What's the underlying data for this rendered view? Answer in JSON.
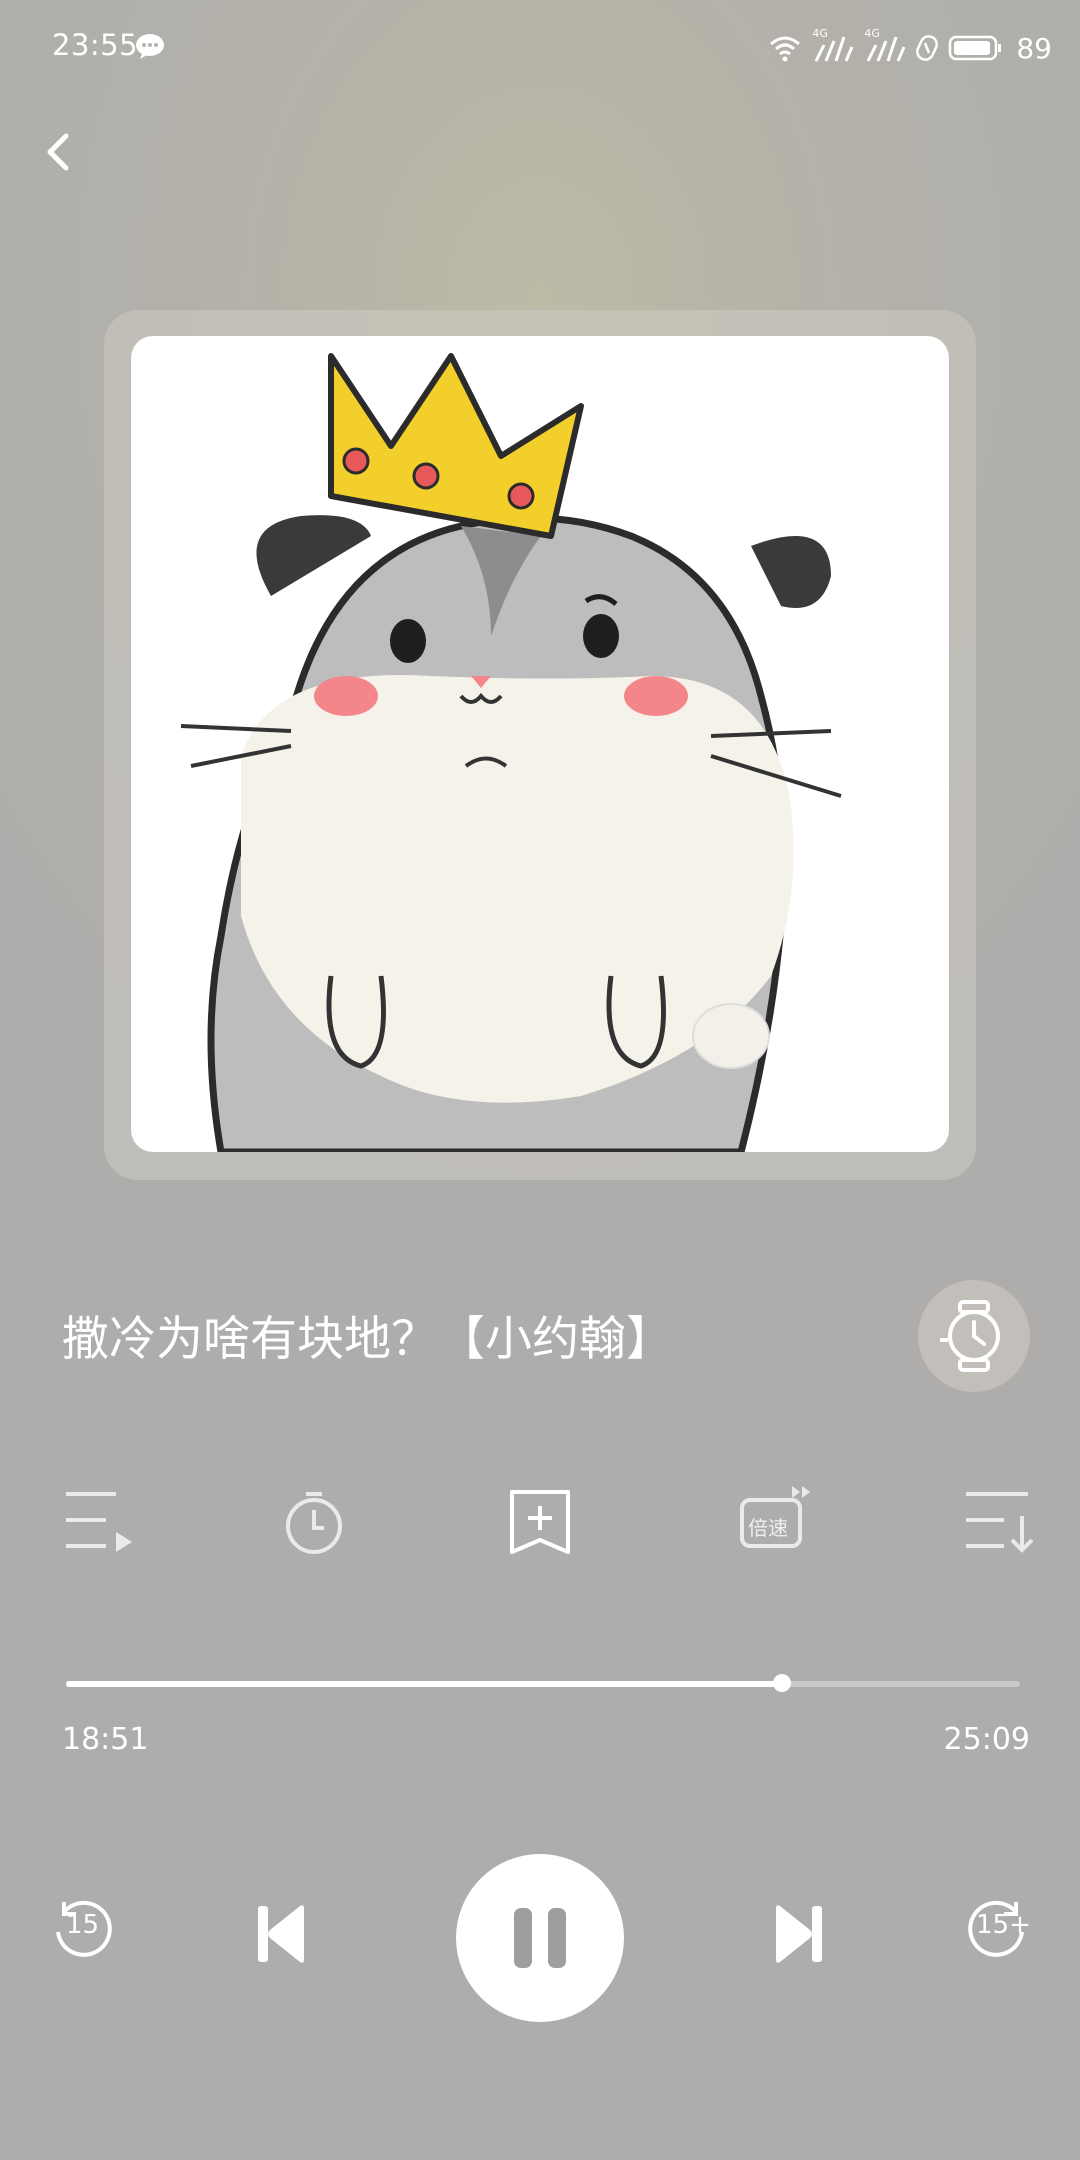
{
  "status_bar": {
    "time": "23:55",
    "network_1": "4G",
    "network_2": "4G",
    "battery": "89"
  },
  "player": {
    "title": "撒冷为啥有块地？【小约翰】",
    "current_time": "18:51",
    "total_time": "25:09",
    "progress": 0.75,
    "rewind_label": "15",
    "forward_label": "15+",
    "speed_label": "倍速"
  },
  "colors": {
    "accent": "#ffffff",
    "crown": "#f3cf2c",
    "hamster_gray": "#b9b9b9",
    "cheek": "#f4858a"
  }
}
